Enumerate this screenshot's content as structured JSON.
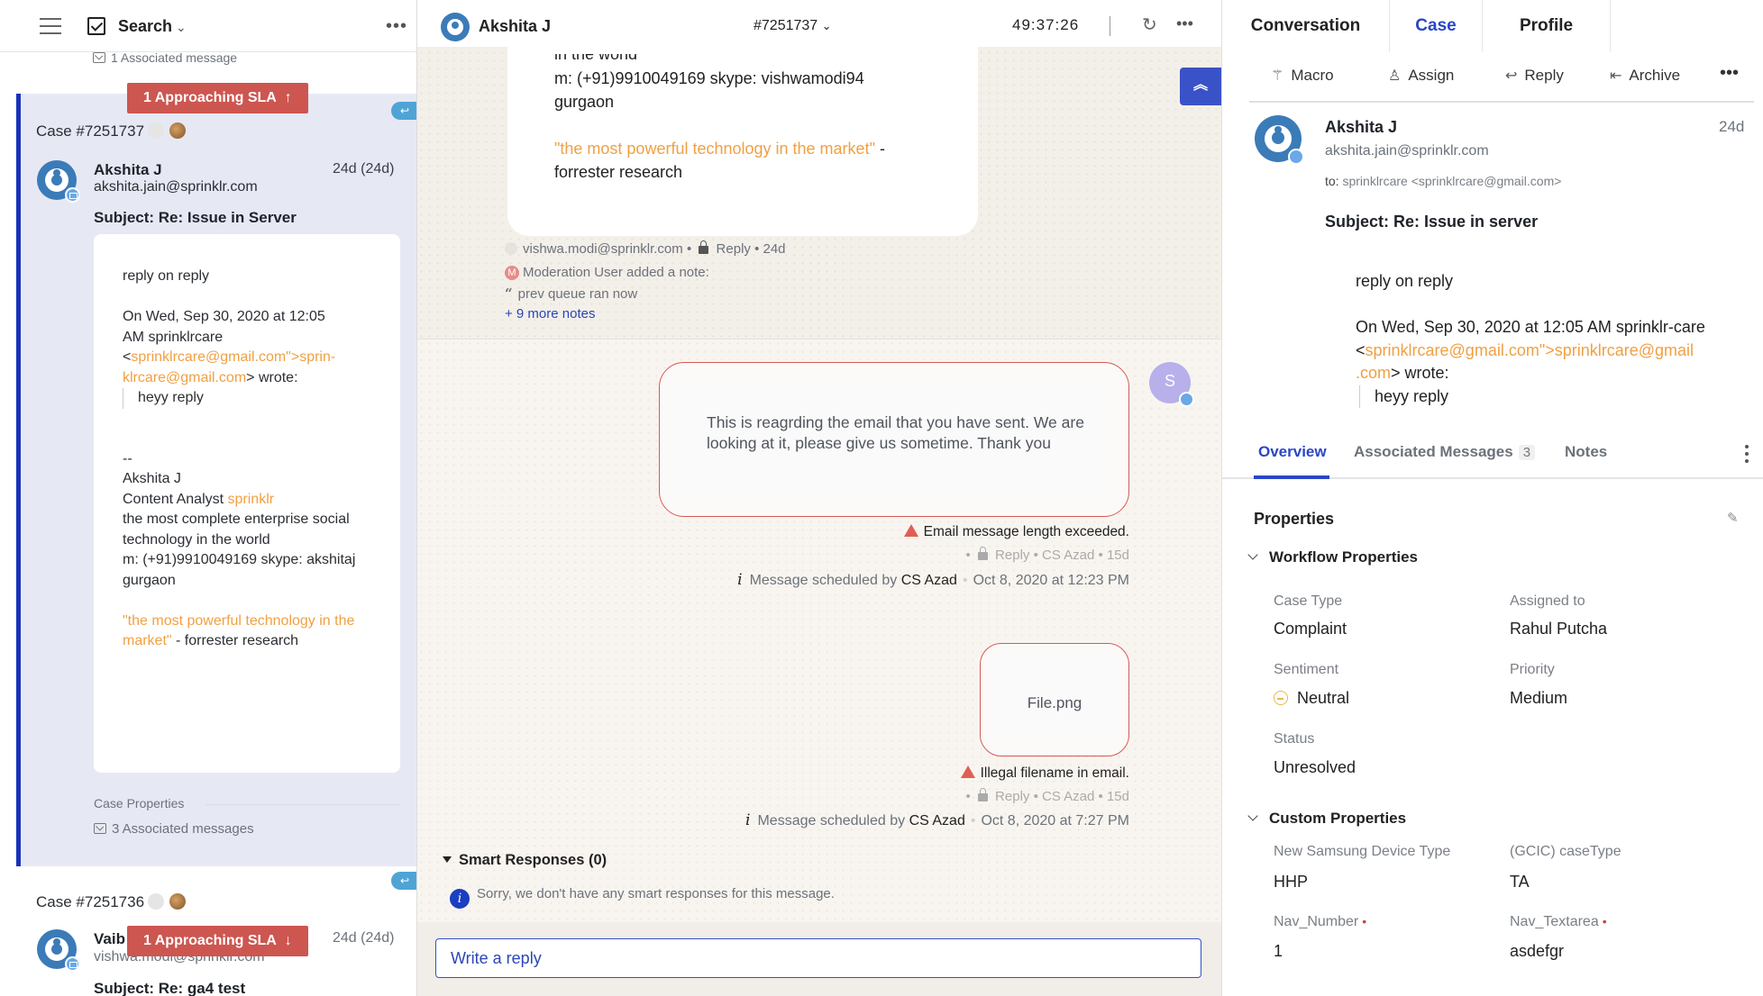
{
  "left_panel": {
    "header": {
      "title": "Search",
      "more_label": "•••"
    },
    "top_associated": "1 Associated message",
    "cases": [
      {
        "id_label": "Case #7251737",
        "sla_badge": "1 Approaching SLA",
        "sla_arrow": "↑",
        "sender_name": "Akshita J",
        "sender_email": "akshita.jain@sprinklr.com",
        "age": "24d (24d)",
        "subject": "Subject: Re: Issue in Server",
        "body": {
          "line1": "reply on reply",
          "quote_intro_1": "On Wed, Sep 30, 2020 at 12:05",
          "quote_intro_2": "AM sprinklrcare",
          "link_prefix": "<",
          "link_1": "sprinklrcare@gmail.com\">sprin-",
          "link_2": "klrcare@gmail.com",
          "link_suffix": "> wrote:",
          "quoted": "heyy reply",
          "sig_dash": "--",
          "sig_name": "Akshita J",
          "sig_role": "Content Analyst ",
          "sig_company": "sprinklr",
          "sig_tag_1": "the most complete enterprise social",
          "sig_tag_2": "technology in the world",
          "sig_contact": "m: (+91)9910049169 skype: akshitaj",
          "sig_city": "gurgaon",
          "sig_quote_1": "\"the most powerful technology in the",
          "sig_quote_2": "market\"",
          "sig_quote_src": " - forrester research"
        },
        "case_properties_label": "Case Properties",
        "associated_label": "3 Associated messages"
      },
      {
        "id_label": "Case #7251736",
        "sla_badge": "1 Approaching SLA",
        "sla_arrow": "↓",
        "sender_name": "Vaib",
        "sender_email": "vishwa.modi@sprinklr.com",
        "age": "24d (24d)",
        "subject": "Subject: Re: ga4 test"
      }
    ]
  },
  "center_panel": {
    "header": {
      "contact_name": "Akshita J",
      "case_number": "#7251737",
      "timer": "49:37:26"
    },
    "previous_message": {
      "line_cut": "in the world",
      "contact": "m: (+91)9910049169 skype: vishwamodi94",
      "city": "gurgaon",
      "quote": "\"the most powerful technology in the market\"",
      "quote_dash": " -",
      "quote_src": "forrester research"
    },
    "previous_meta": {
      "email": "vishwa.modi@sprinklr.com",
      "type": "Reply",
      "age": "24d"
    },
    "note": {
      "author_initial": "M",
      "header": "Moderation User added a note:",
      "text": "prev queue ran now",
      "more": "+ 9 more notes"
    },
    "outgoing": [
      {
        "text": "This is reagrding the email that you have sent. We are looking at it, please give us sometime. Thank you",
        "warning": "Email message length exceeded.",
        "meta_type": "Reply",
        "meta_agent": "CS Azad",
        "meta_age": "15d",
        "scheduled_prefix": "Message scheduled by",
        "scheduled_by": "CS Azad",
        "scheduled_at": "Oct 8, 2020 at 12:23 PM"
      },
      {
        "text": "File.png",
        "warning": "Illegal filename in email.",
        "meta_type": "Reply",
        "meta_agent": "CS Azad",
        "meta_age": "15d",
        "scheduled_prefix": "Message scheduled by",
        "scheduled_by": "CS Azad",
        "scheduled_at": "Oct 8, 2020 at 7:27 PM"
      }
    ],
    "agent_avatar_initial": "S",
    "smart_responses": {
      "title": "Smart Responses (0)",
      "empty_text": "Sorry, we don't have any smart responses for this message."
    },
    "composer": {
      "placeholder": "Write a reply"
    }
  },
  "right_panel": {
    "tabs": [
      {
        "label": "Conversation",
        "active": false
      },
      {
        "label": "Case",
        "active": true
      },
      {
        "label": "Profile",
        "active": false
      }
    ],
    "actions": [
      {
        "label": "Macro",
        "icon": "magic-wand-icon"
      },
      {
        "label": "Assign",
        "icon": "assign-user-icon"
      },
      {
        "label": "Reply",
        "icon": "reply-arrow-icon"
      },
      {
        "label": "Archive",
        "icon": "archive-icon"
      }
    ],
    "message": {
      "sender_name": "Akshita J",
      "sender_email": "akshita.jain@sprinklr.com",
      "age": "24d",
      "to_label": "to:",
      "to_value": "sprinklrcare <sprinklrcare@gmail.com>",
      "subject": "Subject: Re: Issue in server",
      "body_line1": "reply on reply",
      "quote_intro": "On Wed, Sep 30, 2020 at 12:05 AM sprinklr-care",
      "link_prefix": "<",
      "link_1": "sprinklrcare@gmail.com\">sprinklrcare@gmail",
      "link_2": ".com",
      "link_suffix": "> wrote:",
      "quoted": "heyy reply"
    },
    "subtabs": [
      {
        "label": "Overview",
        "active": true
      },
      {
        "label": "Associated Messages",
        "count": "3",
        "active": false
      },
      {
        "label": "Notes",
        "active": false
      }
    ],
    "properties": {
      "title": "Properties",
      "workflow": {
        "title": "Workflow Properties",
        "fields": [
          {
            "label": "Case Type",
            "value": "Complaint"
          },
          {
            "label": "Assigned to",
            "value": "Rahul Putcha"
          },
          {
            "label": "Sentiment",
            "value": "Neutral"
          },
          {
            "label": "Priority",
            "value": "Medium"
          },
          {
            "label": "Status",
            "value": "Unresolved"
          }
        ]
      },
      "custom": {
        "title": "Custom Properties",
        "fields": [
          {
            "label": "New Samsung Device Type",
            "value": "HHP",
            "required": false
          },
          {
            "label": "(GCIC) caseType",
            "value": "TA",
            "required": false
          },
          {
            "label": "Nav_Number",
            "value": "1",
            "required": true
          },
          {
            "label": "Nav_Textarea",
            "value": "asdefgr",
            "required": true
          }
        ]
      }
    }
  },
  "colors": {
    "accent_blue": "#2a46c6",
    "sla_red": "#cd5650",
    "link_orange": "#f0a043",
    "selected_case_bg": "#e6e9f4",
    "warning_red": "#e05f55"
  }
}
